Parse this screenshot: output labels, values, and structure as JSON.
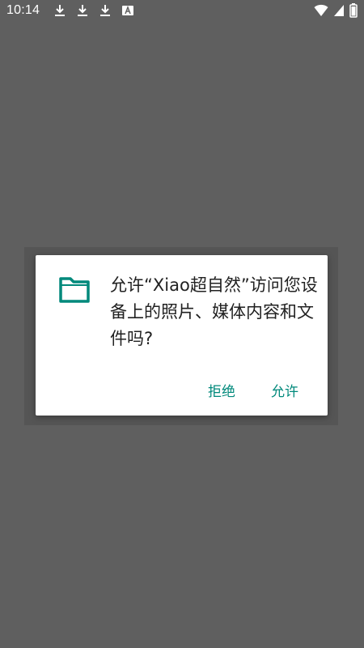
{
  "status_bar": {
    "time": "10:14",
    "left_icons": [
      "download-icon",
      "download-icon",
      "download-icon",
      "a-app-icon"
    ],
    "right_icons": [
      "wifi-icon",
      "signal-icon",
      "battery-icon"
    ]
  },
  "dialog": {
    "icon": "folder-icon",
    "message": "允许“Xiao超自然”访问您设备上的照片、媒体内容和文件吗?",
    "deny_label": "拒绝",
    "allow_label": "允许"
  },
  "colors": {
    "background": "#5f5f5f",
    "dialog_bg": "#ffffff",
    "accent": "#00897b",
    "text": "#212121"
  }
}
